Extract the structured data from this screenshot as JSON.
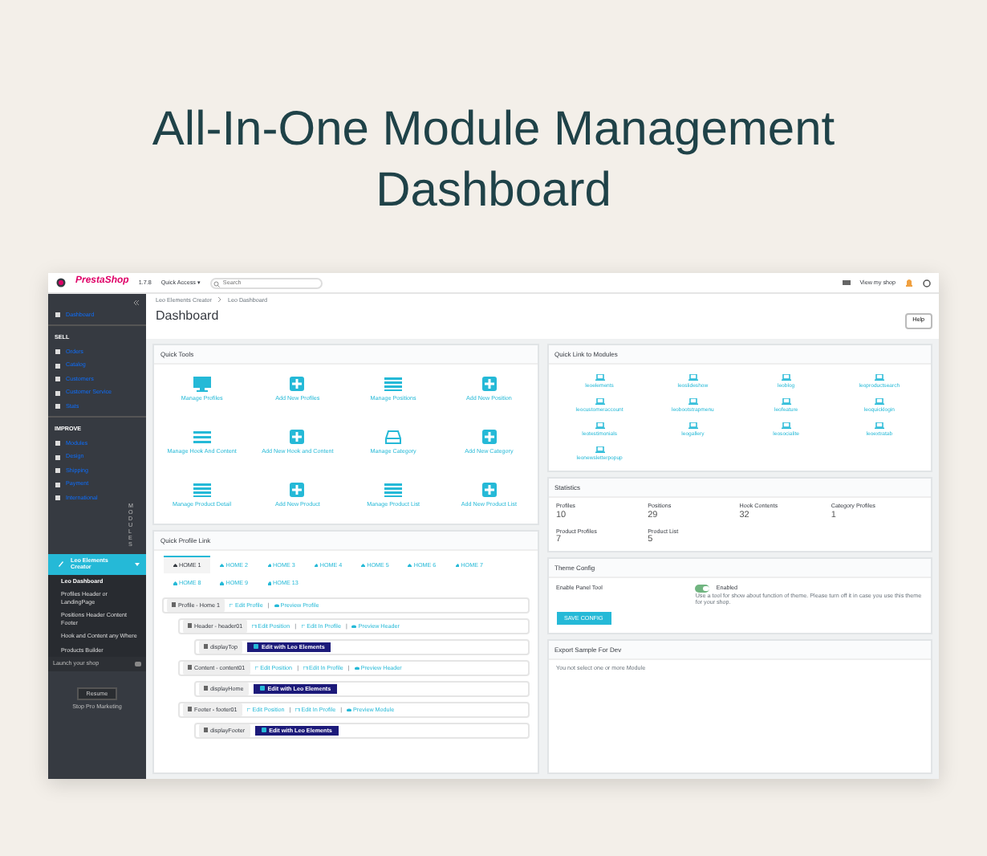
{
  "headline": "All-In-One Module Management Dashboard",
  "topbar": {
    "logo": "PrestaShop",
    "version": "1.7.8",
    "quick_access": "Quick Access ▾",
    "search_placeholder": "Search",
    "view_shop": "View my shop"
  },
  "sidebar": {
    "items": [
      {
        "label": "Dashboard",
        "kind": "link"
      },
      {
        "label": "SELL",
        "kind": "heading"
      },
      {
        "label": "Orders",
        "kind": "link"
      },
      {
        "label": "Catalog",
        "kind": "link"
      },
      {
        "label": "Customers",
        "kind": "link"
      },
      {
        "label": "Customer Service",
        "kind": "link"
      },
      {
        "label": "Stats",
        "kind": "link"
      },
      {
        "label": "IMPROVE",
        "kind": "heading"
      },
      {
        "label": "Modules",
        "kind": "link"
      },
      {
        "label": "Design",
        "kind": "link"
      },
      {
        "label": "Shipping",
        "kind": "link"
      },
      {
        "label": "Payment",
        "kind": "link"
      },
      {
        "label": "International",
        "kind": "link"
      },
      {
        "label": "MODULES",
        "kind": "vertical"
      },
      {
        "label": "Leo Elements Creator",
        "kind": "module",
        "expanded": true,
        "children": [
          {
            "label": "Leo Dashboard",
            "selected": true
          },
          {
            "label": "Profiles Header or LandingPage",
            "selected": false
          },
          {
            "label": "Positions Header Content Footer",
            "selected": false
          },
          {
            "label": "Hook and Content any Where",
            "selected": false
          },
          {
            "label": "Products Builder",
            "selected": false
          }
        ]
      }
    ],
    "launch": "Launch your shop",
    "resume": "Resume",
    "powered": "Stop Pro Marketing"
  },
  "breadcrumb": [
    "Leo Elements Creator",
    "Leo Dashboard"
  ],
  "page_title": "Dashboard",
  "help_button": "Help",
  "quick_tools": {
    "title": "Quick Tools",
    "items": [
      {
        "label": "Manage Profiles",
        "kind": "monitor"
      },
      {
        "label": "Add New Profiles",
        "kind": "plus"
      },
      {
        "label": "Manage Positions",
        "kind": "list"
      },
      {
        "label": "Add New Position",
        "kind": "plus"
      },
      {
        "label": "Manage Hook And Content",
        "kind": "menu"
      },
      {
        "label": "Add New Hook and Content",
        "kind": "plus"
      },
      {
        "label": "Manage Category",
        "kind": "tray"
      },
      {
        "label": "Add New Category",
        "kind": "plus"
      },
      {
        "label": "Manage Product Detail",
        "kind": "list"
      },
      {
        "label": "Add New Product",
        "kind": "plus"
      },
      {
        "label": "Manage Product List",
        "kind": "list"
      },
      {
        "label": "Add New Product List",
        "kind": "plus"
      }
    ]
  },
  "quick_profile": {
    "title": "Quick Profile Link",
    "separator": "|",
    "tabs": [
      {
        "label": "HOME 1",
        "selected": true
      },
      {
        "label": "HOME 2",
        "selected": false
      },
      {
        "label": "HOME 3",
        "selected": false
      },
      {
        "label": "HOME 4",
        "selected": false
      },
      {
        "label": "HOME 5",
        "selected": false
      },
      {
        "label": "HOME 6",
        "selected": false
      },
      {
        "label": "HOME 7",
        "selected": false
      },
      {
        "label": "HOME 8",
        "selected": false
      },
      {
        "label": "HOME 9",
        "selected": false
      },
      {
        "label": "HOME 13",
        "selected": false
      }
    ],
    "rows": [
      {
        "kind": "profile",
        "label": "Profile - Home 1",
        "links": [
          {
            "kind": "edit",
            "label": "Edit Profile"
          },
          {
            "kind": "preview",
            "label": "Preview Profile"
          }
        ]
      },
      {
        "kind": "position",
        "label": "Header - header01",
        "links": [
          {
            "kind": "edit",
            "label": "Edit Position"
          },
          {
            "kind": "edit",
            "label": "Edit In Profile"
          },
          {
            "kind": "preview",
            "label": "Preview Header"
          }
        ]
      },
      {
        "kind": "hook",
        "label": "displayTop",
        "button": "Edit with Leo Elements"
      },
      {
        "kind": "position",
        "label": "Content - content01",
        "links": [
          {
            "kind": "edit",
            "label": "Edit Position"
          },
          {
            "kind": "edit",
            "label": "Edit In Profile"
          },
          {
            "kind": "preview",
            "label": "Preview Header"
          }
        ]
      },
      {
        "kind": "hook",
        "label": "displayHome",
        "button": "Edit with Leo Elements"
      },
      {
        "kind": "position",
        "label": "Footer - footer01",
        "links": [
          {
            "kind": "edit",
            "label": "Edit Position"
          },
          {
            "kind": "edit",
            "label": "Edit In Profile"
          },
          {
            "kind": "preview",
            "label": "Preview Module"
          }
        ]
      },
      {
        "kind": "hook",
        "label": "displayFooter",
        "button": "Edit with Leo Elements"
      }
    ]
  },
  "modules": {
    "title": "Quick Link to Modules",
    "items": [
      "leoelements",
      "leoslideshow",
      "leoblog",
      "leoproductsearch",
      "leocustomeraccount",
      "leobootstrapmenu",
      "leofeature",
      "leoquicklogin",
      "leotestimonials",
      "leogallery",
      "leosocialite",
      "leoextratab",
      "leonewsletterpopup"
    ]
  },
  "statistics": {
    "title": "Statistics",
    "items": [
      {
        "label": "Profiles",
        "value": "10"
      },
      {
        "label": "Positions",
        "value": "29"
      },
      {
        "label": "Hook Contents",
        "value": "32"
      },
      {
        "label": "Category Profiles",
        "value": "1"
      },
      {
        "label": "Product Profiles",
        "value": "7"
      },
      {
        "label": "Product List",
        "value": "5"
      }
    ]
  },
  "theme_config": {
    "title": "Theme Config",
    "field": "Enable Panel Tool",
    "on": true,
    "state": "Enabled",
    "help": "Use a tool for show about function of theme. Please turn off it in case you use this theme for your shop.",
    "save": "SAVE CONFIG"
  },
  "export": {
    "title": "Export Sample For Dev",
    "note": "You not select one or more Module"
  }
}
